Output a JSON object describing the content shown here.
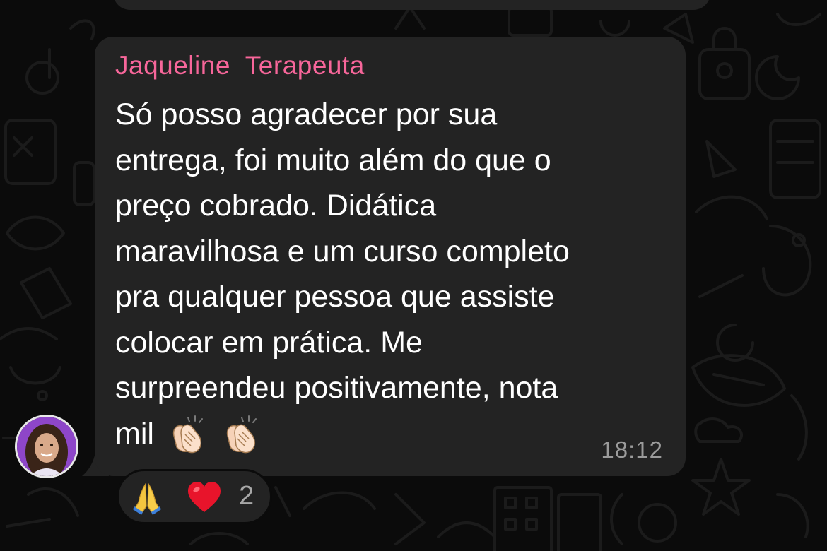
{
  "chat": {
    "sender_name": "Jaqueline  Terapeuta",
    "message_lines": [
      "Só posso agradecer por sua",
      "entrega, foi muito além do que o",
      "preço cobrado. Didática",
      "maravilhosa e um curso completo",
      "pra qualquer pessoa que assiste",
      "colocar em prática. Me",
      "surpreendeu positivamente, nota",
      "mil"
    ],
    "message_emojis": [
      "clapping-hands",
      "clapping-hands"
    ],
    "timestamp": "18:12",
    "reactions": {
      "emojis": [
        "folded-hands",
        "red-heart"
      ],
      "count": "2"
    }
  },
  "colors": {
    "background": "#0b0b0b",
    "bubble": "#232323",
    "sender_name": "#f7669a",
    "message_text": "#ffffff",
    "timestamp": "#9b9b9b"
  }
}
